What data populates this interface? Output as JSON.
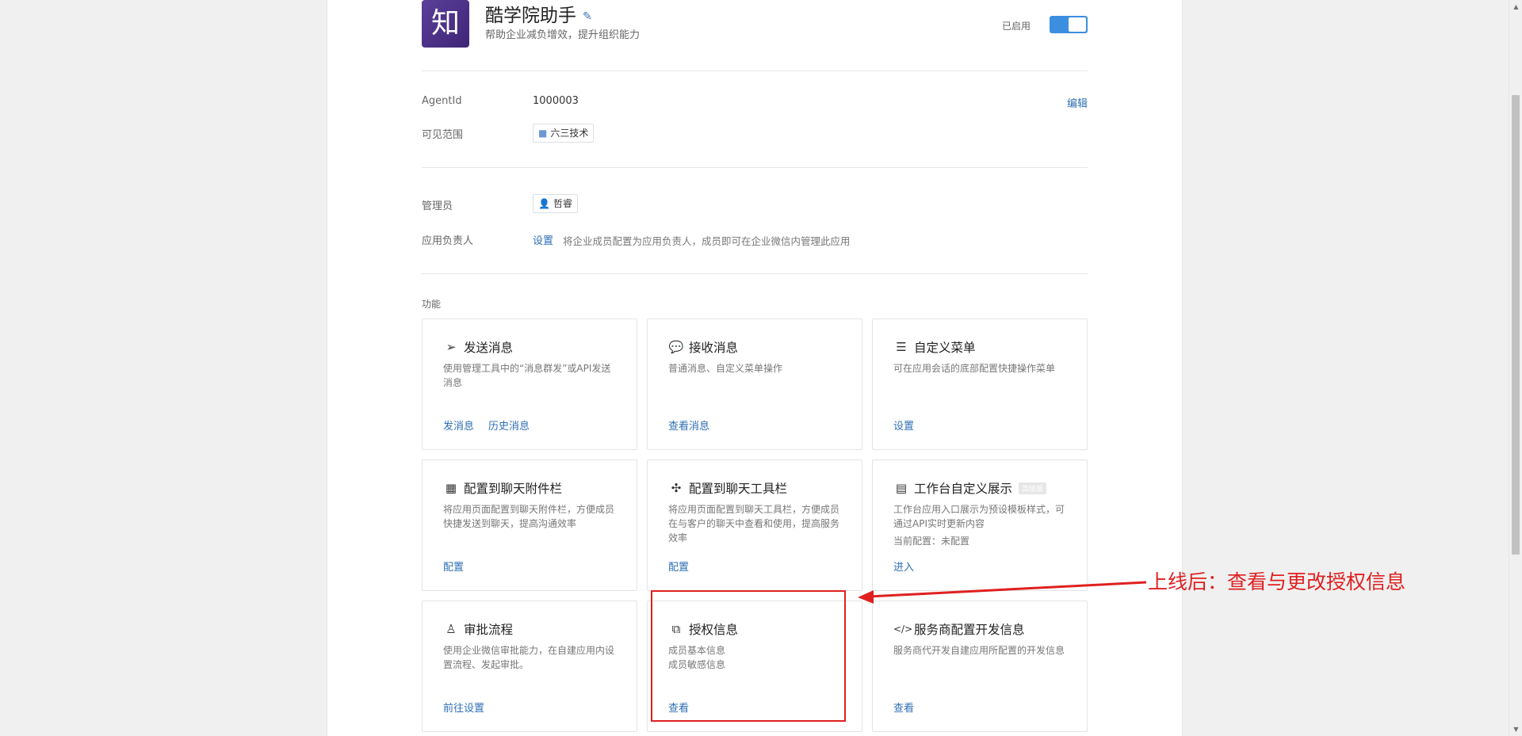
{
  "app": {
    "logo_char": "知",
    "name": "酷学院助手",
    "description": "帮助企业减负增效，提升组织能力",
    "status": "已启用",
    "enabled": true
  },
  "info": {
    "agentid_label": "AgentId",
    "agentid_value": "1000003",
    "edit_label": "编辑",
    "visible_label": "可见范围",
    "visible_value": "六三技术"
  },
  "admin": {
    "admin_label": "管理员",
    "admin_value": "哲睿",
    "owner_label": "应用负责人",
    "owner_link": "设置",
    "owner_hint": "将企业成员配置为应用负责人，成员即可在企业微信内管理此应用"
  },
  "features": {
    "section_title": "功能",
    "cards": [
      {
        "title": "发送消息",
        "icon": "send-icon",
        "desc": "使用管理工具中的“消息群发”或API发送消息",
        "links": [
          "发消息",
          "历史消息"
        ]
      },
      {
        "title": "接收消息",
        "icon": "chat-bubble-icon",
        "desc": "普通消息、自定义菜单操作",
        "links": [
          "查看消息"
        ]
      },
      {
        "title": "自定义菜单",
        "icon": "menu-icon",
        "desc": "可在应用会话的底部配置快捷操作菜单",
        "links": [
          "设置"
        ]
      },
      {
        "title": "配置到聊天附件栏",
        "icon": "attachment-bar-icon",
        "desc": "将应用页面配置到聊天附件栏，方便成员快捷发送到聊天，提高沟通效率",
        "links": [
          "配置"
        ]
      },
      {
        "title": "配置到聊天工具栏",
        "icon": "toolbar-icon",
        "desc": "将应用页面配置到聊天工具栏，方便成员在与客户的聊天中查看和使用，提高服务效率",
        "links": [
          "配置"
        ]
      },
      {
        "title": "工作台自定义展示",
        "icon": "workbench-icon",
        "badge": "高级版",
        "desc": "工作台应用入口展示为预设模板样式，可通过API实时更新内容",
        "extra": "当前配置：未配置",
        "links": [
          "进入"
        ]
      },
      {
        "title": "审批流程",
        "icon": "stamp-icon",
        "desc": "使用企业微信审批能力，在自建应用内设置流程、发起审批。",
        "links": [
          "前往设置"
        ]
      },
      {
        "title": "授权信息",
        "icon": "authorization-icon",
        "desc": "成员基本信息",
        "desc2": "成员敏感信息",
        "links": [
          "查看"
        ]
      },
      {
        "title": "服务商配置开发信息",
        "icon": "code-icon",
        "desc": "服务商代开发自建应用所配置的开发信息",
        "links": [
          "查看"
        ]
      }
    ]
  },
  "annotation": {
    "text": "上线后：查看与更改授权信息",
    "color": "#e02020"
  }
}
